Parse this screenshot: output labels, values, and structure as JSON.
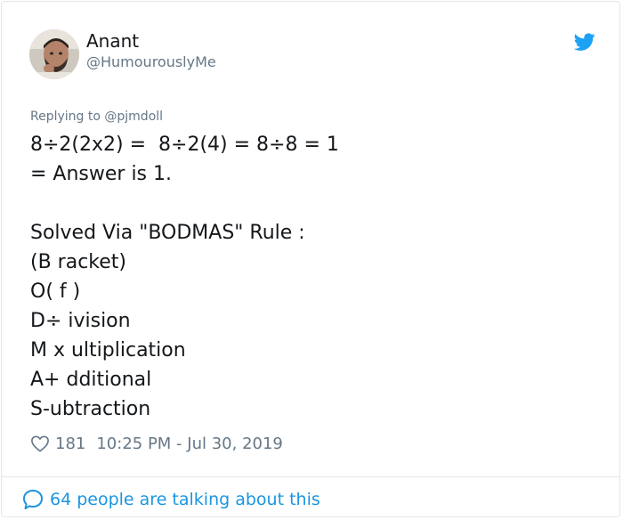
{
  "tweet": {
    "author_name": "Anant",
    "author_handle": "@HumourouslyMe",
    "replying_prefix": "Replying to",
    "replying_to": "@pjmdoll",
    "lines": [
      "8÷2(2x2) =  8÷2(4) = 8÷8 = 1",
      "= Answer is 1.",
      "",
      "Solved Via \"BODMAS\" Rule :",
      "(B racket)",
      "O( f )",
      "D÷ ivision",
      "M x ultiplication",
      "A+ dditional",
      "S-ubtraction"
    ],
    "likes": "181",
    "timestamp": "10:25 PM - Jul 30, 2019",
    "talking": "64 people are talking about this"
  },
  "icons": {
    "brand": "twitter-bird-icon",
    "like": "heart-icon",
    "reply": "speech-bubble-icon"
  },
  "colors": {
    "twitter_blue": "#1da1f2",
    "link_blue": "#1b95e0",
    "muted": "#657786",
    "text": "#14171a"
  }
}
